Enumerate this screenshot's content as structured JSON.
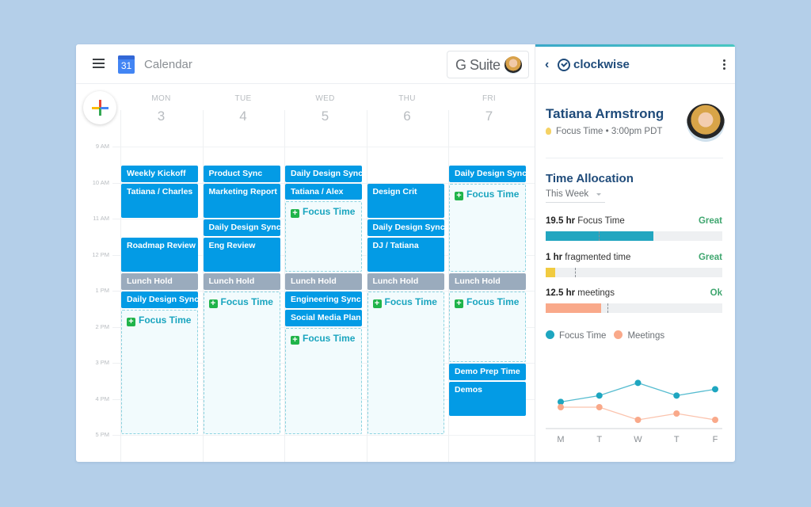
{
  "calendar": {
    "app_title": "Calendar",
    "logo_day": "31",
    "gsuite_label": "G Suite",
    "create_label": "+",
    "days": [
      {
        "name": "MON",
        "num": "3"
      },
      {
        "name": "TUE",
        "num": "4"
      },
      {
        "name": "WED",
        "num": "5"
      },
      {
        "name": "THU",
        "num": "6"
      },
      {
        "name": "FRI",
        "num": "7"
      }
    ],
    "times": [
      "9 AM",
      "10 AM",
      "11 AM",
      "12 PM",
      "1 PM",
      "2 PM",
      "3 PM",
      "4 PM",
      "5 PM"
    ],
    "events": [
      {
        "day": 0,
        "start": 9.5,
        "end": 10.0,
        "title": "Weekly Kickoff",
        "type": "blue"
      },
      {
        "day": 0,
        "start": 10.0,
        "end": 11.0,
        "title": "Tatiana / Charles",
        "type": "blue"
      },
      {
        "day": 0,
        "start": 11.5,
        "end": 12.5,
        "title": "Roadmap Review",
        "type": "blue"
      },
      {
        "day": 0,
        "start": 12.5,
        "end": 13.0,
        "title": "Lunch Hold",
        "type": "gray"
      },
      {
        "day": 0,
        "start": 13.0,
        "end": 13.5,
        "title": "Daily Design Sync",
        "type": "blue"
      },
      {
        "day": 0,
        "start": 13.5,
        "end": 17.0,
        "title": "Focus Time",
        "type": "focus"
      },
      {
        "day": 1,
        "start": 9.5,
        "end": 10.0,
        "title": "Product Sync",
        "type": "blue"
      },
      {
        "day": 1,
        "start": 10.0,
        "end": 11.0,
        "title": "Marketing Report",
        "type": "blue"
      },
      {
        "day": 1,
        "start": 11.0,
        "end": 11.5,
        "title": "Daily Design Sync",
        "type": "blue"
      },
      {
        "day": 1,
        "start": 11.5,
        "end": 12.5,
        "title": "Eng Review",
        "type": "blue"
      },
      {
        "day": 1,
        "start": 12.5,
        "end": 13.0,
        "title": "Lunch Hold",
        "type": "gray"
      },
      {
        "day": 1,
        "start": 13.0,
        "end": 17.0,
        "title": "Focus Time",
        "type": "focus"
      },
      {
        "day": 2,
        "start": 9.5,
        "end": 10.0,
        "title": "Daily Design Sync",
        "type": "blue"
      },
      {
        "day": 2,
        "start": 10.0,
        "end": 10.5,
        "title": "Tatiana / Alex",
        "type": "blue"
      },
      {
        "day": 2,
        "start": 10.5,
        "end": 12.5,
        "title": "Focus Time",
        "type": "focus"
      },
      {
        "day": 2,
        "start": 12.5,
        "end": 13.0,
        "title": "Lunch Hold",
        "type": "gray"
      },
      {
        "day": 2,
        "start": 13.0,
        "end": 13.5,
        "title": "Engineering Sync",
        "type": "blue"
      },
      {
        "day": 2,
        "start": 13.5,
        "end": 14.0,
        "title": "Social Media Plan",
        "type": "blue"
      },
      {
        "day": 2,
        "start": 14.0,
        "end": 17.0,
        "title": "Focus Time",
        "type": "focus"
      },
      {
        "day": 3,
        "start": 10.0,
        "end": 11.0,
        "title": "Design Crit",
        "type": "blue"
      },
      {
        "day": 3,
        "start": 11.0,
        "end": 11.5,
        "title": "Daily Design Sync",
        "type": "blue"
      },
      {
        "day": 3,
        "start": 11.5,
        "end": 12.5,
        "title": "DJ / Tatiana",
        "type": "blue"
      },
      {
        "day": 3,
        "start": 12.5,
        "end": 13.0,
        "title": "Lunch Hold",
        "type": "gray"
      },
      {
        "day": 3,
        "start": 13.0,
        "end": 17.0,
        "title": "Focus Time",
        "type": "focus"
      },
      {
        "day": 4,
        "start": 9.5,
        "end": 10.0,
        "title": "Daily Design Sync",
        "type": "blue"
      },
      {
        "day": 4,
        "start": 10.0,
        "end": 12.5,
        "title": "Focus Time",
        "type": "focus"
      },
      {
        "day": 4,
        "start": 12.5,
        "end": 13.0,
        "title": "Lunch Hold",
        "type": "gray"
      },
      {
        "day": 4,
        "start": 13.0,
        "end": 15.0,
        "title": "Focus Time",
        "type": "focus"
      },
      {
        "day": 4,
        "start": 15.0,
        "end": 15.5,
        "title": "Demo Prep Time",
        "type": "blue"
      },
      {
        "day": 4,
        "start": 15.5,
        "end": 16.5,
        "title": "Demos",
        "type": "blue"
      }
    ]
  },
  "clockwise": {
    "brand": "clockwise",
    "back_label": "‹",
    "user": {
      "name": "Tatiana Armstrong",
      "status": "Focus Time • 3:00pm PDT"
    },
    "time_allocation": {
      "title": "Time Allocation",
      "period": "This Week",
      "metrics": [
        {
          "value": "19.5 hr",
          "label": "Focus Time",
          "rating": "Great",
          "fill": 0.61,
          "target": 0.3,
          "color": "#22a6c0"
        },
        {
          "value": "1 hr",
          "label": "fragmented time",
          "rating": "Great",
          "fill": 0.055,
          "target": 0.165,
          "color": "#f1cb40"
        },
        {
          "value": "12.5 hr",
          "label": "meetings",
          "rating": "Ok",
          "fill": 0.315,
          "target": 0.35,
          "color": "#f9a98a"
        }
      ]
    }
  },
  "chart_data": {
    "type": "line",
    "categories": [
      "M",
      "T",
      "W",
      "T",
      "F"
    ],
    "series": [
      {
        "name": "Focus Time",
        "color": "#1ea6c0",
        "values": [
          3.2,
          3.8,
          5.0,
          3.8,
          4.4
        ]
      },
      {
        "name": "Meetings",
        "color": "#f9a98a",
        "values": [
          2.7,
          2.7,
          1.5,
          2.1,
          1.5
        ]
      }
    ],
    "ylim": [
      0,
      6
    ],
    "grid": false,
    "legend": "top-left"
  }
}
